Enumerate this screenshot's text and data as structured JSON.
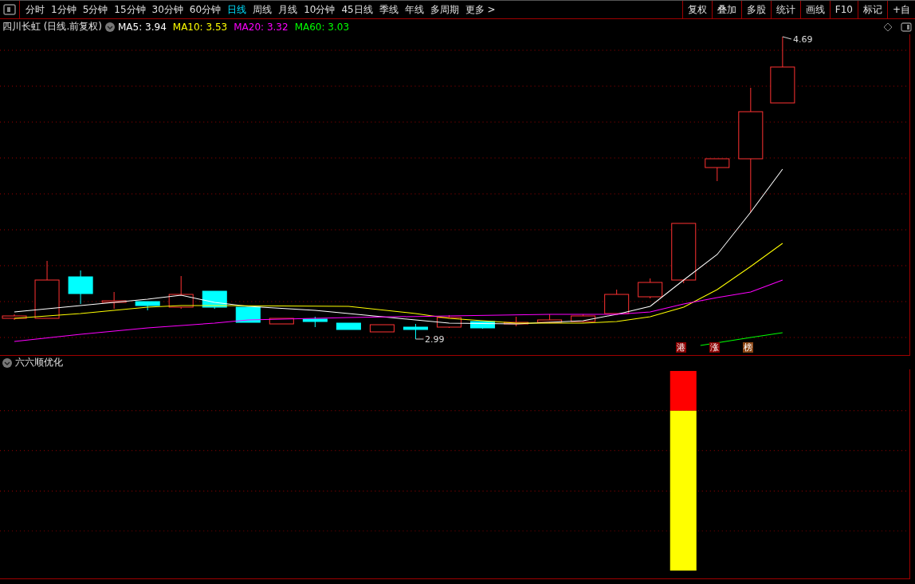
{
  "toolbar": {
    "tabs": [
      {
        "label": "分时",
        "selected": false
      },
      {
        "label": "1分钟",
        "selected": false
      },
      {
        "label": "5分钟",
        "selected": false
      },
      {
        "label": "15分钟",
        "selected": false
      },
      {
        "label": "30分钟",
        "selected": false
      },
      {
        "label": "60分钟",
        "selected": false
      },
      {
        "label": "日线",
        "selected": true
      },
      {
        "label": "周线",
        "selected": false
      },
      {
        "label": "月线",
        "selected": false
      },
      {
        "label": "10分钟",
        "selected": false
      },
      {
        "label": "45日线",
        "selected": false
      },
      {
        "label": "季线",
        "selected": false
      },
      {
        "label": "年线",
        "selected": false
      },
      {
        "label": "多周期",
        "selected": false
      },
      {
        "label": "更多 >",
        "selected": false
      }
    ],
    "buttons": [
      "复权",
      "叠加",
      "多股",
      "统计",
      "画线",
      "F10",
      "标记",
      "+自"
    ]
  },
  "chart": {
    "title": "四川长虹 (日线.前复权)",
    "averages": [
      {
        "label": "MA5: 3.94",
        "color": "#ffffff"
      },
      {
        "label": "MA10: 3.53",
        "color": "#ffff00"
      },
      {
        "label": "MA20: 3.32",
        "color": "#ff00ff"
      },
      {
        "label": "MA60: 3.03",
        "color": "#00ff00"
      }
    ],
    "high_label": "4.69",
    "low_label": "2.99",
    "tags": [
      {
        "label": "港",
        "color": "#8b0000"
      },
      {
        "label": "涨",
        "color": "#8b0000"
      },
      {
        "label": "榜",
        "color": "#8b4513"
      }
    ]
  },
  "indicator": {
    "title": "六六顺优化"
  }
}
